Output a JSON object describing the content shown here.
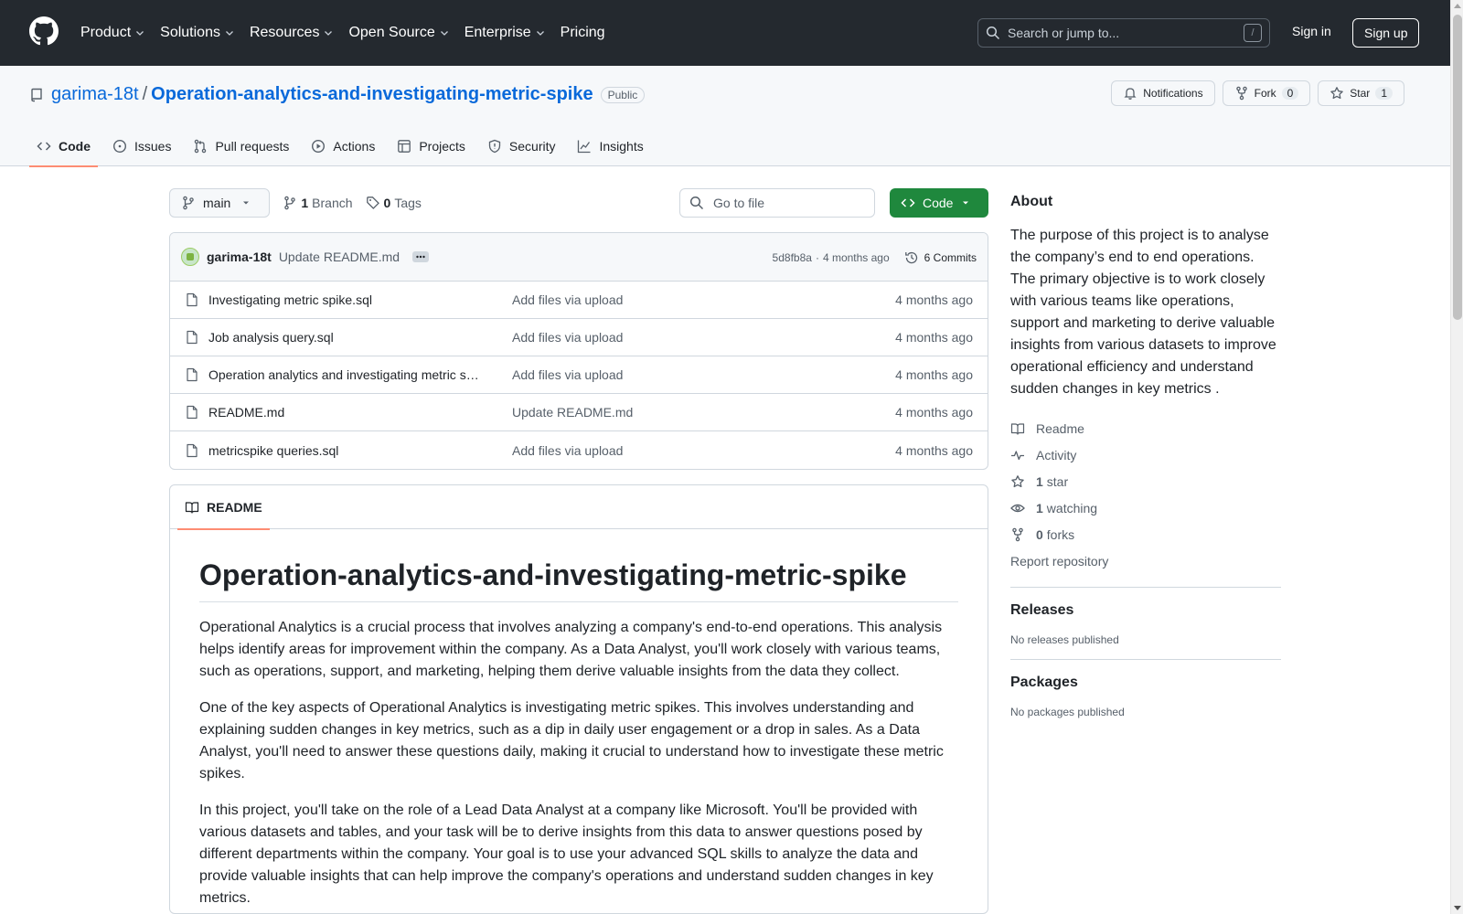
{
  "header": {
    "nav": [
      {
        "label": "Product",
        "has_dropdown": true
      },
      {
        "label": "Solutions",
        "has_dropdown": true
      },
      {
        "label": "Resources",
        "has_dropdown": true
      },
      {
        "label": "Open Source",
        "has_dropdown": true
      },
      {
        "label": "Enterprise",
        "has_dropdown": true
      },
      {
        "label": "Pricing",
        "has_dropdown": false
      }
    ],
    "search_placeholder": "Search or jump to...",
    "search_key": "/",
    "sign_in": "Sign in",
    "sign_up": "Sign up"
  },
  "repo": {
    "owner": "garima-18t",
    "separator": "/",
    "name": "Operation-analytics-and-investigating-metric-spike",
    "visibility": "Public",
    "notifications_label": "Notifications",
    "fork_label": "Fork",
    "fork_count": "0",
    "star_label": "Star",
    "star_count": "1"
  },
  "tabs": [
    {
      "label": "Code",
      "icon": "code-icon",
      "active": true
    },
    {
      "label": "Issues",
      "icon": "issue-icon",
      "active": false
    },
    {
      "label": "Pull requests",
      "icon": "pull-request-icon",
      "active": false
    },
    {
      "label": "Actions",
      "icon": "play-icon",
      "active": false
    },
    {
      "label": "Projects",
      "icon": "table-icon",
      "active": false
    },
    {
      "label": "Security",
      "icon": "shield-icon",
      "active": false
    },
    {
      "label": "Insights",
      "icon": "graph-icon",
      "active": false
    }
  ],
  "toolbar": {
    "branch": "main",
    "branch_count": "1",
    "branch_label": "Branch",
    "tag_count": "0",
    "tag_label": "Tags",
    "goto_placeholder": "Go to file",
    "code_button": "Code"
  },
  "latest_commit": {
    "author": "garima-18t",
    "message": "Update README.md",
    "hash": "5d8fb8a",
    "dot": "·",
    "time": "4 months ago",
    "commits_label": "6 Commits"
  },
  "files": [
    {
      "name": "Investigating metric spike.sql",
      "message": "Add files via upload",
      "date": "4 months ago"
    },
    {
      "name": "Job analysis query.sql",
      "message": "Add files via upload",
      "date": "4 months ago"
    },
    {
      "name": "Operation analytics and investigating metric s…",
      "message": "Add files via upload",
      "date": "4 months ago"
    },
    {
      "name": "README.md",
      "message": "Update README.md",
      "date": "4 months ago"
    },
    {
      "name": "metricspike queries.sql",
      "message": "Add files via upload",
      "date": "4 months ago"
    }
  ],
  "readme": {
    "tab_label": "README",
    "title": "Operation-analytics-and-investigating-metric-spike",
    "paragraphs": [
      "Operational Analytics is a crucial process that involves analyzing a company's end-to-end operations. This analysis helps identify areas for improvement within the company. As a Data Analyst, you'll work closely with various teams, such as operations, support, and marketing, helping them derive valuable insights from the data they collect.",
      "One of the key aspects of Operational Analytics is investigating metric spikes. This involves understanding and explaining sudden changes in key metrics, such as a dip in daily user engagement or a drop in sales. As a Data Analyst, you'll need to answer these questions daily, making it crucial to understand how to investigate these metric spikes.",
      "In this project, you'll take on the role of a Lead Data Analyst at a company like Microsoft. You'll be provided with various datasets and tables, and your task will be to derive insights from this data to answer questions posed by different departments within the company. Your goal is to use your advanced SQL skills to analyze the data and provide valuable insights that can help improve the company's operations and understand sudden changes in key metrics."
    ]
  },
  "sidebar": {
    "about_title": "About",
    "about_text": "The purpose of this project is to analyse the company’s end to end operations. The primary objective is to work closely with various teams like operations, support and marketing to derive valuable insights from various datasets to improve operational efficiency and understand sudden changes in key metrics .",
    "readme_label": "Readme",
    "activity_label": "Activity",
    "stars_count": "1",
    "stars_label": "star",
    "watching_count": "1",
    "watching_label": "watching",
    "forks_count": "0",
    "forks_label": "forks",
    "report_label": "Report repository",
    "releases_title": "Releases",
    "releases_text": "No releases published",
    "packages_title": "Packages",
    "packages_text": "No packages published"
  }
}
